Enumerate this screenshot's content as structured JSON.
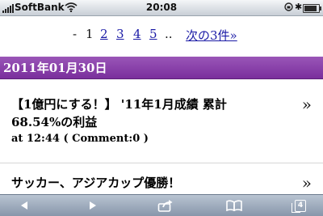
{
  "status_bar": {
    "carrier": "SoftBank",
    "time": "20:08",
    "battery_level": 0.9
  },
  "pager": {
    "dash": "-",
    "current": "1",
    "pages": [
      "2",
      "3",
      "4",
      "5"
    ],
    "ellipsis": "..",
    "next_label": "次の3件»"
  },
  "date_header": "2011年01月30日",
  "posts": [
    {
      "title_line1": "【1億円にする！】 '11年1月成績 累計",
      "title_line2": "68.54%の利益",
      "meta": "at 12:44 ( Comment:0 )",
      "arrow": "»"
    },
    {
      "title_line1": "サッカー、アジアカップ優勝！",
      "arrow": "»"
    }
  ],
  "toolbar": {
    "tab_count": "4"
  }
}
